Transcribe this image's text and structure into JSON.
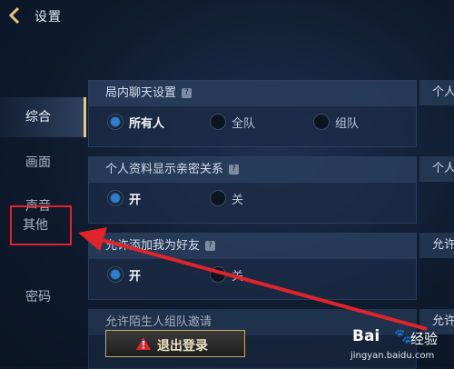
{
  "header": {
    "title": "设置"
  },
  "sidebar": {
    "items": [
      {
        "label": "综合"
      },
      {
        "label": "画面"
      },
      {
        "label": "声音"
      },
      {
        "label": "其他"
      },
      {
        "label": "密码"
      }
    ]
  },
  "panels": {
    "chat": {
      "title": "局内聊天设置",
      "options": [
        "所有人",
        "全队",
        "组队"
      ],
      "selected": "所有人"
    },
    "profile": {
      "title": "个人资料显示亲密关系",
      "options": [
        "开",
        "关"
      ],
      "selected": "开"
    },
    "friend": {
      "title": "允许添加我为好友",
      "options": [
        "开",
        "关"
      ],
      "selected": "开"
    },
    "partial": {
      "title": "允许陌生人组队邀请"
    }
  },
  "right_column": {
    "stubs": [
      "个人",
      "个人",
      "允许",
      "允许"
    ]
  },
  "logout": {
    "label": "退出登录"
  },
  "help_glyph": "?",
  "watermark": {
    "brand": "Bai",
    "word": "经验",
    "site": "jingyan.baidu.com"
  },
  "colors": {
    "accent_gold": "#e8c77a",
    "highlight_red": "#e0242a",
    "radio_on": "#2f7fd0"
  }
}
